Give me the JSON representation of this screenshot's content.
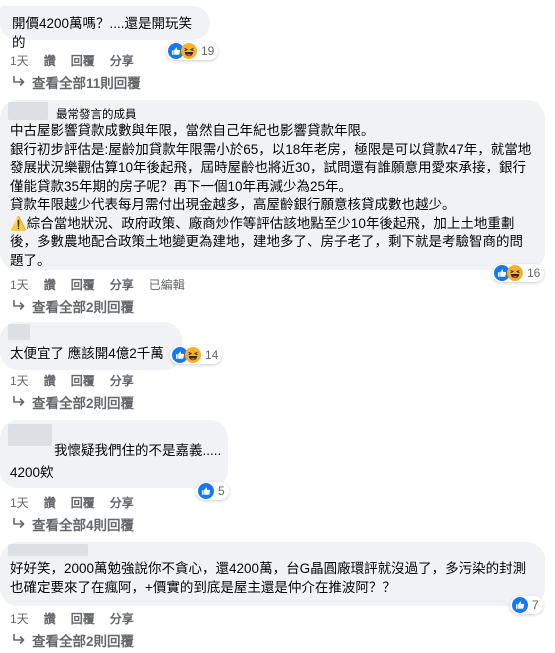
{
  "comments": [
    {
      "text": "開價4200萬嗎？....還是開玩笑的",
      "actions": [
        "1天",
        "讚",
        "回覆",
        "分享"
      ],
      "reaction_count": "19",
      "reaction_types": [
        "like",
        "haha"
      ],
      "replies": "查看全部11則回覆"
    },
    {
      "author_tag": "最常發言的成員",
      "text": "中古屋影響貸款成數與年限，當然自己年紀也影響貸款年限。\n銀行初步評估是:屋齡加貸款年限需小於65，以18年老房，極限是可以貸款47年，就當地發展狀況樂觀估算10年後起飛，屆時屋齡也將近30，試問還有誰願意用愛來承接，銀行僅能貸款35年期的房子呢？再下一個10年再減少為25年。\n貸款年限越少代表每月需付出現金越多，高屋齡銀行願意核貸成數也越少。\n⚠️綜合當地狀況、政府政策、廠商炒作等評估該地點至少10年後起飛，加上土地重劃後，多數農地配合政策土地變更為建地，建地多了、房子老了，剩下就是考驗智商的問題了。",
      "actions": [
        "1天",
        "讚",
        "回覆",
        "分享",
        "已編輯"
      ],
      "reaction_count": "16",
      "reaction_types": [
        "like",
        "haha"
      ],
      "replies": "查看全部2則回覆"
    },
    {
      "text": "太便宜了 應該開4億2千萬",
      "actions": [
        "1天",
        "讚",
        "回覆",
        "分享"
      ],
      "reaction_count": "14",
      "reaction_types": [
        "like",
        "haha"
      ],
      "replies": "查看全部2則回覆"
    },
    {
      "text_line1": "我懷疑我們住的不是嘉義.....",
      "text_line2": "4200欸",
      "actions": [
        "1天",
        "讚",
        "回覆",
        "分享"
      ],
      "reaction_count": "5",
      "reaction_types": [
        "like"
      ],
      "replies": "查看全部4則回覆"
    },
    {
      "text": "好好笑，2000萬勉強說你不貪心，還4200萬，台G晶圓廠環評就沒過了，多污染的封測也確定要來了在瘋阿，+價實的到底是屋主還是仲介在推波阿？？",
      "actions": [
        "1天",
        "讚",
        "回覆",
        "分享"
      ],
      "reaction_count": "7",
      "reaction_types": [
        "like"
      ],
      "replies": "查看全部2則回覆"
    }
  ],
  "colors": {
    "bubble": "#f0f2f5",
    "muted": "#65676b",
    "like": "#1877f2",
    "haha": "#f7b125"
  }
}
